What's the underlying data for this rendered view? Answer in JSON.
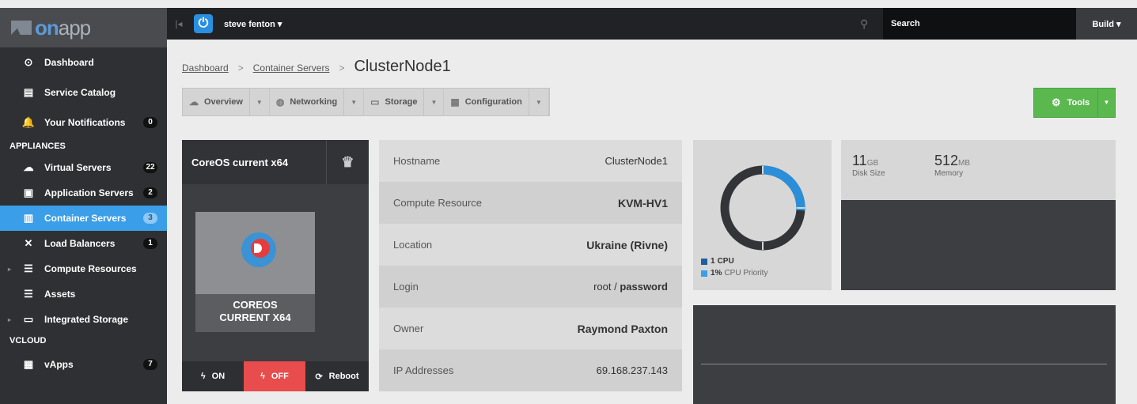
{
  "brand": {
    "on": "on",
    "app": "app"
  },
  "topbar": {
    "user": "steve fenton",
    "user_caret": "▾",
    "search_placeholder": "Search",
    "build_label": "Build ▾"
  },
  "sidebar": {
    "items_top": [
      {
        "label": "Dashboard",
        "icon": "dashboard-icon"
      },
      {
        "label": "Service Catalog",
        "icon": "catalog-icon"
      },
      {
        "label": "Your Notifications",
        "icon": "bell-icon",
        "badge": "0"
      }
    ],
    "section_appliances": "APPLIANCES",
    "appliances": [
      {
        "label": "Virtual Servers",
        "icon": "cloud-icon",
        "badge": "22"
      },
      {
        "label": "Application Servers",
        "icon": "window-icon",
        "badge": "2"
      },
      {
        "label": "Container Servers",
        "icon": "container-icon",
        "badge": "3",
        "active": true
      },
      {
        "label": "Load Balancers",
        "icon": "balancer-icon",
        "badge": "1"
      },
      {
        "label": "Compute Resources",
        "icon": "server-icon"
      },
      {
        "label": "Assets",
        "icon": "assets-icon"
      },
      {
        "label": "Integrated Storage",
        "icon": "storage-icon"
      }
    ],
    "section_vcloud": "VCLOUD",
    "vcloud": [
      {
        "label": "vApps",
        "icon": "vapps-icon",
        "badge": "7"
      }
    ]
  },
  "breadcrumb": {
    "root": "Dashboard",
    "parent": "Container Servers",
    "sep": ">",
    "current": "ClusterNode1"
  },
  "tabs": [
    {
      "label": "Overview",
      "icon": "cloud-icon"
    },
    {
      "label": "Networking",
      "icon": "globe-icon"
    },
    {
      "label": "Storage",
      "icon": "hdd-icon"
    },
    {
      "label": "Configuration",
      "icon": "grid-icon"
    }
  ],
  "tools": {
    "label": "Tools"
  },
  "vm": {
    "title": "CoreOS current x64",
    "caption_line1": "COREOS",
    "caption_line2": "CURRENT X64",
    "on_label": "ON",
    "off_label": "OFF",
    "reboot_label": "Reboot"
  },
  "details": [
    {
      "label": "Hostname",
      "value": "ClusterNode1",
      "bold": false
    },
    {
      "label": "Compute Resource",
      "value": "KVM-HV1",
      "bold": true
    },
    {
      "label": "Location",
      "value": "Ukraine (Rivne)",
      "bold": true
    },
    {
      "label": "Login",
      "value_prefix": "root / ",
      "value": "password",
      "bold": false
    },
    {
      "label": "Owner",
      "value": "Raymond Paxton",
      "bold": true
    },
    {
      "label": "IP Addresses",
      "value": "69.168.237.143",
      "bold": false
    }
  ],
  "cpu": {
    "cpu_count": "1",
    "cpu_label": "CPU",
    "priority": "1%",
    "priority_label": "CPU Priority",
    "priority_fraction": 0.26,
    "colors": {
      "used": "#2a8fd8",
      "rest": "#333438",
      "legend_cpu": "#1f5f9e",
      "legend_prio": "#3b9ee8"
    }
  },
  "disk": {
    "size": "11",
    "size_unit": "GB",
    "size_label": "Disk Size",
    "memory": "512",
    "memory_unit": "MB",
    "memory_label": "Memory"
  },
  "colors": {
    "accent": "#3b9ee8",
    "off": "#e84c4c",
    "tools": "#5ab84f"
  }
}
